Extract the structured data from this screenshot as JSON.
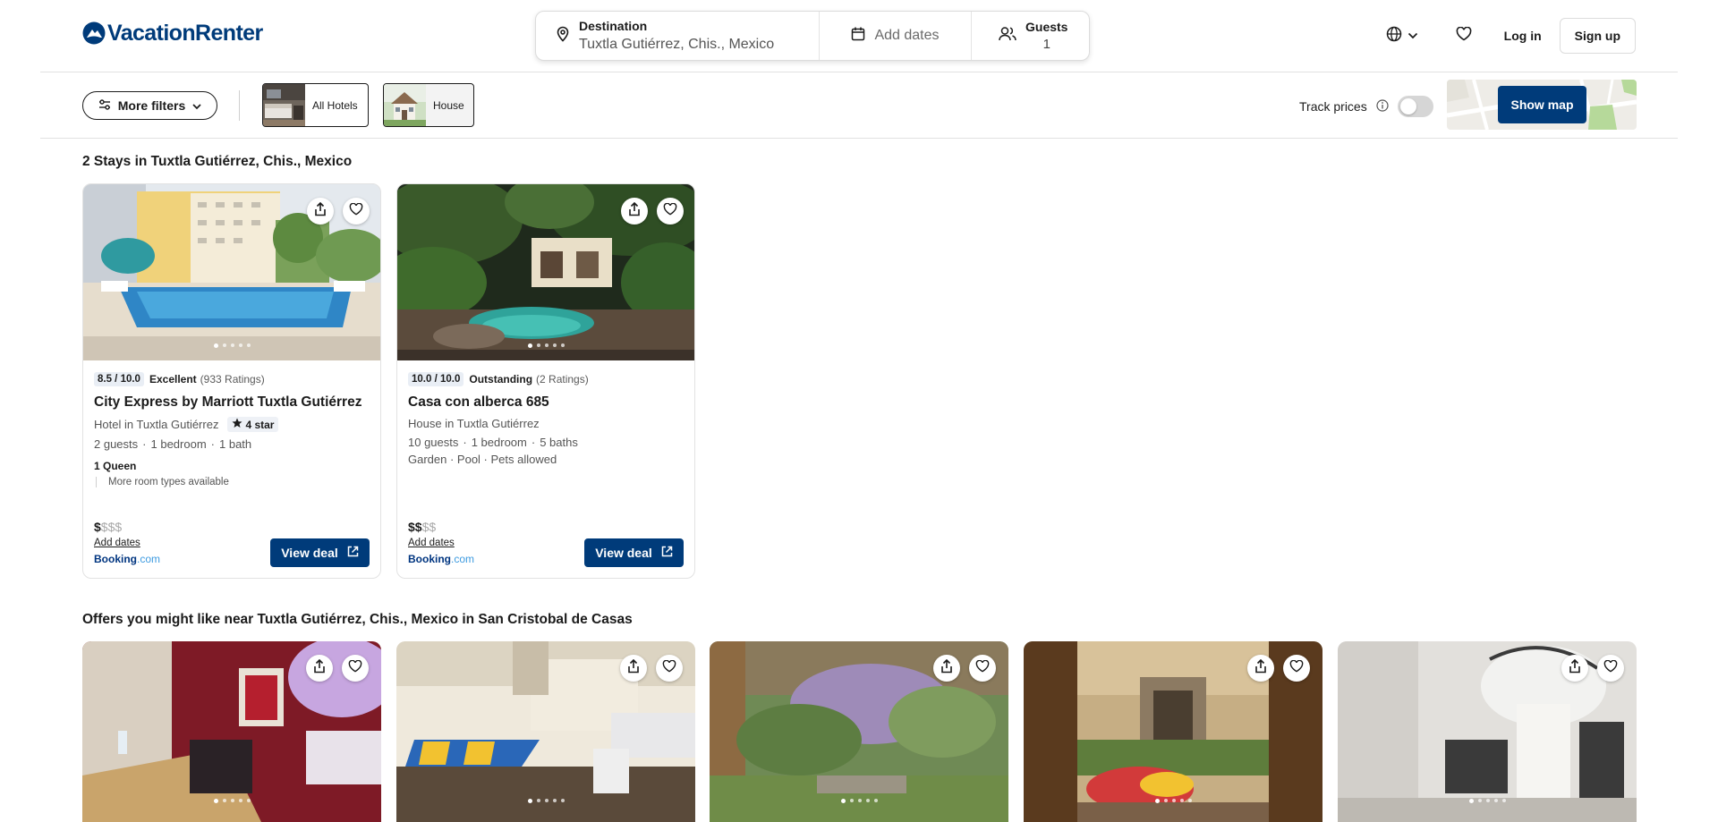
{
  "brand": {
    "name": "VacationRenter",
    "color": "#003b7a"
  },
  "search": {
    "destination_label": "Destination",
    "destination_value": "Tuxtla Gutiérrez, Chis., Mexico",
    "dates_placeholder": "Add dates",
    "guests_label": "Guests",
    "guests_value": "1"
  },
  "header": {
    "language_icon": "globe-icon",
    "favorites_icon": "heart-icon",
    "login_label": "Log in",
    "signup_label": "Sign up"
  },
  "filters": {
    "more_filters_label": "More filters",
    "chips": [
      {
        "label": "All Hotels"
      },
      {
        "label": "House"
      }
    ],
    "track_prices_label": "Track prices",
    "show_map_label": "Show map"
  },
  "results": {
    "title": "2 Stays in Tuxtla Gutiérrez, Chis., Mexico",
    "cards": [
      {
        "score": "8.5 / 10.0",
        "rating_word": "Excellent",
        "rating_count": "(933 Ratings)",
        "name": "City Express by Marriott Tuxtla Gutiérrez",
        "type": "Hotel in Tuxtla Gutiérrez",
        "star_badge": "4 star",
        "guests": "2 guests",
        "bedrooms": "1 bedroom",
        "baths": "1 bath",
        "bed": "1 Queen",
        "room_more": "More room types available",
        "price_bold": "$",
        "price_muted": "$$$",
        "add_dates": "Add dates",
        "provider_name": "Booking",
        "provider_suffix": ".com",
        "cta": "View deal"
      },
      {
        "score": "10.0 / 10.0",
        "rating_word": "Outstanding",
        "rating_count": "(2 Ratings)",
        "name": "Casa con alberca 685",
        "type": "House in Tuxtla Gutiérrez",
        "guests": "10 guests",
        "bedrooms": "1 bedroom",
        "baths": "5 baths",
        "amenities": "Garden · Pool · Pets allowed",
        "price_bold": "$$",
        "price_muted": "$$",
        "add_dates": "Add dates",
        "provider_name": "Booking",
        "provider_suffix": ".com",
        "cta": "View deal"
      }
    ]
  },
  "offers": {
    "title": "Offers you might like near Tuxtla Gutiérrez, Chis., Mexico in San Cristobal de Casas"
  }
}
